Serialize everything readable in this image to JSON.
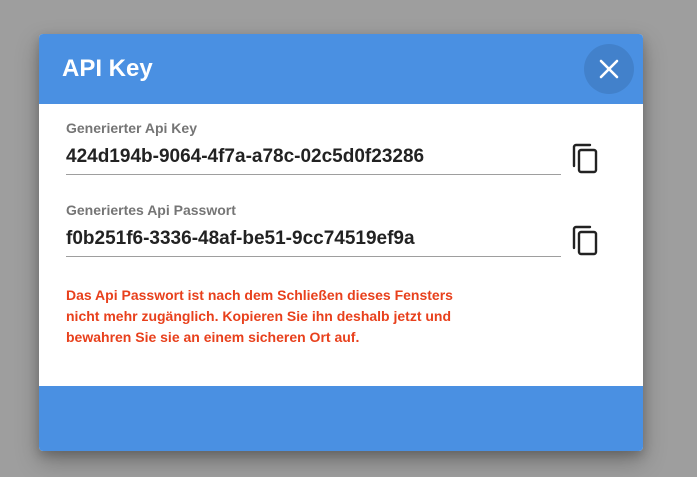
{
  "dialog": {
    "title": "API Key",
    "close_icon": "close-icon"
  },
  "fields": {
    "api_key": {
      "label": "Generierter Api Key",
      "value": "424d194b-9064-4f7a-a78c-02c5d0f23286",
      "copy_icon": "copy-icon"
    },
    "api_password": {
      "label": "Generiertes Api Passwort",
      "value": "f0b251f6-3336-48af-be51-9cc74519ef9a",
      "copy_icon": "copy-icon"
    }
  },
  "warning": {
    "lines": [
      "Das Api Passwort ist nach dem Schließen dieses Fensters",
      "nicht mehr zugänglich. Kopieren Sie ihn deshalb jetzt und",
      "bewahren Sie sie an einem sicheren Ort auf."
    ]
  },
  "colors": {
    "header": "#4a90e2",
    "footer": "#4a90e2",
    "warning": "#e8401c",
    "backdrop": "#9e9e9e"
  }
}
